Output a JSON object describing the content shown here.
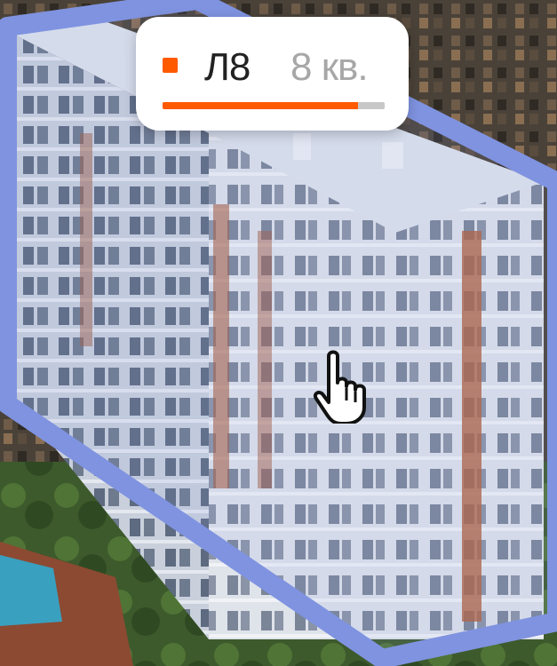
{
  "building_label": {
    "code": "Л8",
    "quarter": "8 кв.",
    "progress": 0.88,
    "colors": {
      "accent": "#ff5a00",
      "track": "#c8c8c8",
      "code": "#222222",
      "quarter": "#a7a7a7"
    }
  },
  "highlight": {
    "color": "#7f93e0"
  },
  "cursor": {
    "icon": "hand-pointer-icon"
  }
}
